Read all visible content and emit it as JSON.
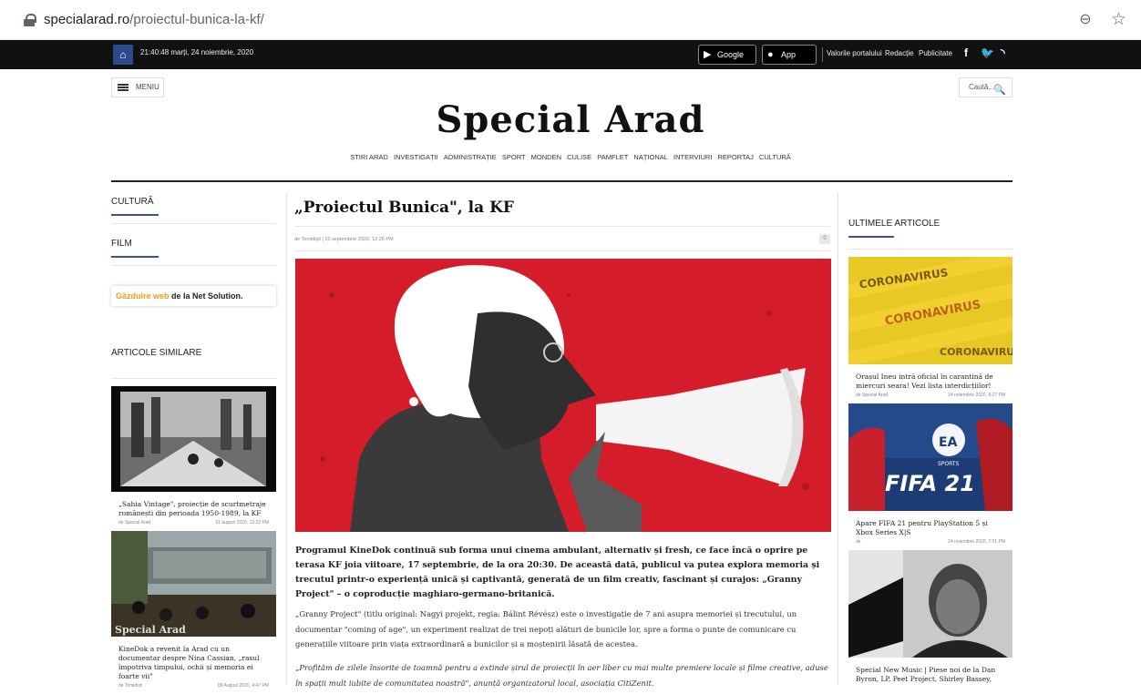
{
  "browser": {
    "url_domain": "specialarad.ro",
    "url_path": "/proiectul-bunica-la-kf/"
  },
  "topbar": {
    "datetime": "21:40:48 marți, 24 noiembrie, 2020",
    "google_play": "Google Play",
    "app_store": "App Store",
    "links": [
      "Valorile portalului",
      "Redacție",
      "Publicitate"
    ]
  },
  "header": {
    "menu_label": "MENIU",
    "search_placeholder": "Caută...",
    "logo": "Special Arad",
    "nav": [
      "ȘTIRI ARAD",
      "INVESTIGAȚII",
      "ADMINISTRAȚIE",
      "SPORT",
      "MONDEN",
      "CULISE",
      "PAMFLET",
      "NAȚIONAL",
      "INTERVIURI",
      "REPORTAJ",
      "CULTURĂ"
    ]
  },
  "left": {
    "section1": "CULTURĂ",
    "section2": "FILM",
    "hosting_orange": "Găzduire web",
    "hosting_rest": " de la Net Solution.",
    "similar_heading": "ARTICOLE SIMILARE",
    "cards": [
      {
        "title": "„Sahia Vintage\", proiecție de scurtmetraje românești din perioada 1950-1989, la KF",
        "author": "de Special Arad",
        "date": "31 august 2020, 12:32 PM"
      },
      {
        "title": "KineDok a revenit la Arad cu un documentar despre Nina Cassian, „rasul împotriva timpului, ochii și memoria ei foarte vii\"",
        "author": "de Tomidiști",
        "date": "09 August 2020, 4:47 PM"
      }
    ]
  },
  "article": {
    "title": "„Proiectul Bunica\", la KF",
    "meta": "de Tomidiști | 10 septembrie 2020, 12:26 PM",
    "comments": "0",
    "lead": "Programul KineDok continuă sub forma unui cinema ambulant, alternativ și fresh, ce face încă o oprire pe terasa KF joia viitoare, 17 septembrie, de la ora 20:30. De această dată, publicul va putea explora memoria și trecutul printr-o experiență unică și captivantă, generată de un film creativ, fascinant și curajos: „Granny Project\" – o coproducție maghiaro-germano-britanică.",
    "p1": "„Granny Project\" (titlu original: Nagyi projekt, regia: Bálint Révész) este o investigație de 7 ani asupra memoriei și trecutului, un documentar \"coming of age\", un experiment realizat de trei nepoți alături de bunicile lor, spre a forma o punte de comunicare cu generațiile viitoare prin viața extraordinară a bunicilor și a moștenirii lăsată de acestea.",
    "p2": "„Profităm de zilele însorite de toamnă pentru a extinde șirul de proiecții în aer liber cu mai multe premiere locale și filme creative, aduse în spații mult iubite de comunitatea noastră\", anunță organizatorul local, asociația CitiZenit."
  },
  "right": {
    "heading": "ULTIMELE ARTICOLE",
    "items": [
      {
        "title": "Orașul Ineu intră oficial în carantină de miercuri seara! Vezi lista interdicțiilor!",
        "author": "de Special Arad",
        "date": "24 noiembrie 2020, 8:27 PM"
      },
      {
        "title": "Apare FIFA 21 pentru PlayStation 5 și Xbox Series X|S",
        "author": "de",
        "date": "24 noiembrie 2020, 7:01 PM"
      },
      {
        "title": "Special New Music | Piese noi de la Dan Byron, LP, Peet Project, Shirley Bassey,",
        "author": "",
        "date": ""
      }
    ],
    "img_text": [
      "CORONAVIRUS",
      "FIFA 21",
      "SPORTS",
      "EA"
    ]
  }
}
